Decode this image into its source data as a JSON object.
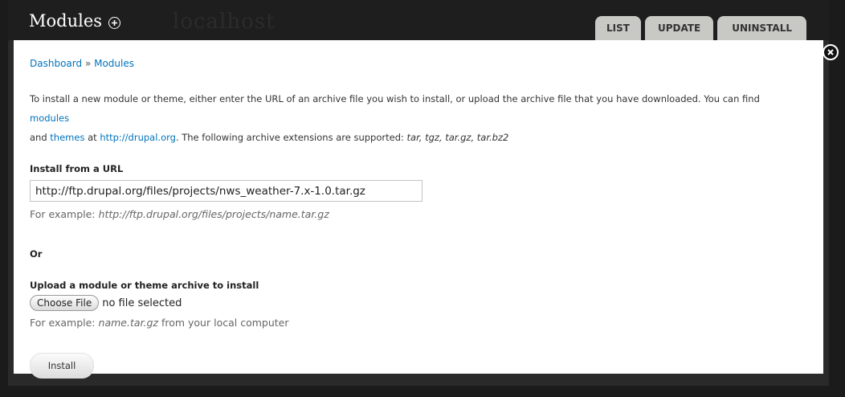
{
  "header": {
    "title": "Modules",
    "ghost_text": "localhost",
    "tabs": [
      {
        "label": "LIST"
      },
      {
        "label": "UPDATE"
      },
      {
        "label": "UNINSTALL"
      }
    ]
  },
  "breadcrumb": {
    "items": [
      "Dashboard",
      "Modules"
    ],
    "separator": "»"
  },
  "intro": {
    "text_1": "To install a new module or theme, either enter the URL of an archive file you wish to install, or upload the archive file that you have downloaded. You can find",
    "link_modules": "modules",
    "text_2": "and",
    "link_themes": "themes",
    "text_3": "at",
    "link_drupal": "http://drupal.org",
    "text_4": ". The following archive extensions are supported:",
    "extensions": "tar, tgz, tar.gz, tar.bz2"
  },
  "url_section": {
    "label": "Install from a URL",
    "value": "http://ftp.drupal.org/files/projects/nws_weather-7.x-1.0.tar.gz",
    "example_prefix": "For example:",
    "example": "http://ftp.drupal.org/files/projects/name.tar.gz"
  },
  "or_label": "Or",
  "upload_section": {
    "label": "Upload a module or theme archive to install",
    "choose_button": "Choose File",
    "no_file": "no file selected",
    "example_prefix": "For example:",
    "example": "name.tar.gz",
    "example_suffix": "from your local computer"
  },
  "install_button": "Install",
  "colors": {
    "link": "#0074bd",
    "header_bg": "#1e1e1e",
    "tab_bg": "#c8c8c4"
  }
}
